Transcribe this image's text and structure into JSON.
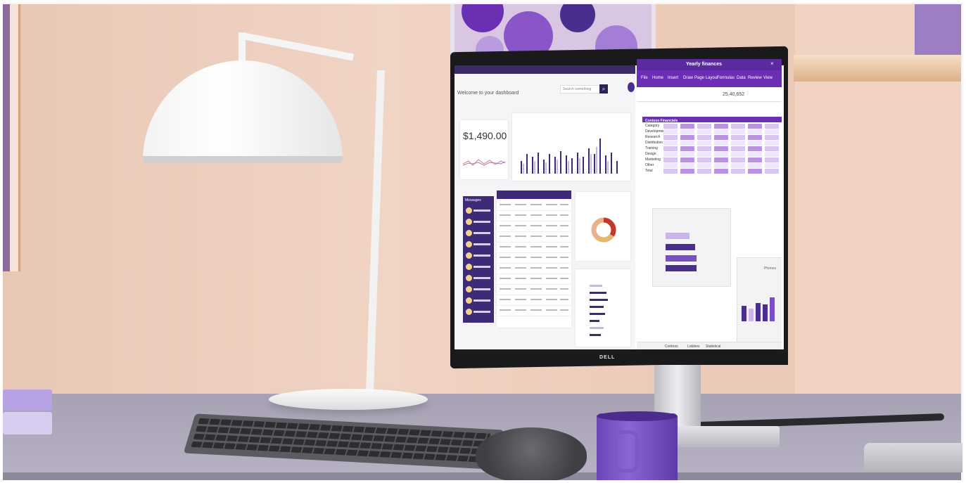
{
  "dashboard": {
    "title": "Welcome to your dashboard",
    "search_placeholder": "Search something",
    "amount": "$1,490.00",
    "messages_title": "Messages"
  },
  "spreadsheet": {
    "window_title": "Yearly finances",
    "menu": [
      "File",
      "Home",
      "Insert",
      "Draw",
      "Page Layout",
      "Formulas",
      "Data",
      "Review",
      "View"
    ],
    "cell_value": "25,40,652",
    "table_title": "Contoso Financials",
    "row_labels": [
      "Category",
      "Development",
      "Research",
      "Distribution",
      "Training",
      "Design",
      "Marketing",
      "Other",
      "Total"
    ],
    "tabs": [
      "Contoso",
      "Lobbies",
      "Statistical"
    ],
    "phones_title": "Phones"
  },
  "monitor": {
    "logo": "DELL"
  },
  "colors": {
    "accent": "#5a2a9e",
    "wall": "#efcfbd",
    "desk": "#aaa5b7"
  }
}
